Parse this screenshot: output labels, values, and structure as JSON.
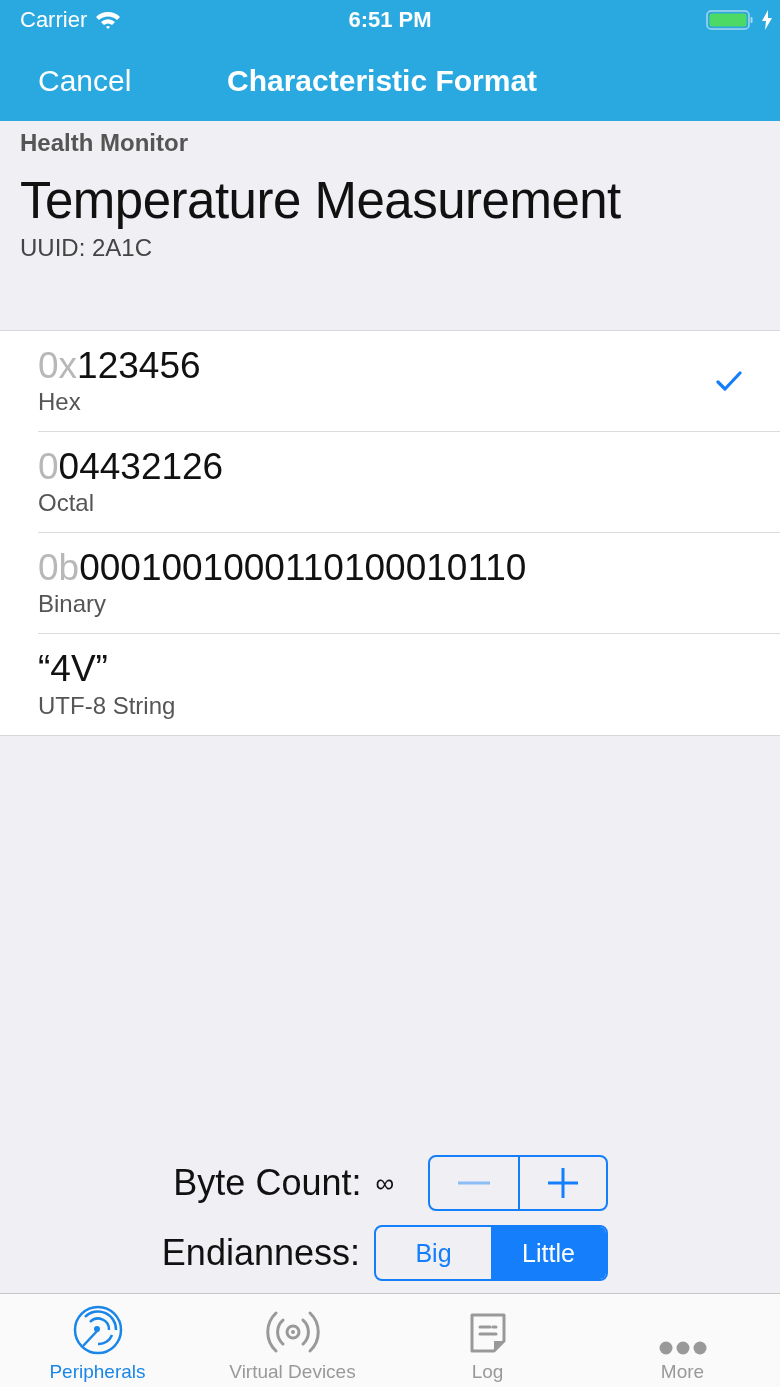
{
  "status_bar": {
    "carrier": "Carrier",
    "time": "6:51 PM"
  },
  "nav_bar": {
    "left_button": "Cancel",
    "title": "Characteristic Format"
  },
  "header": {
    "service": "Health Monitor",
    "characteristic": "Temperature Measurement",
    "uuid": "UUID: 2A1C"
  },
  "formats": [
    {
      "prefix": "0x",
      "value": "123456",
      "label": "Hex",
      "selected": true
    },
    {
      "prefix": "0",
      "value": "04432126",
      "label": "Octal",
      "selected": false
    },
    {
      "prefix": "0b",
      "value": "0001001000110100010110",
      "label": "Binary",
      "selected": false
    },
    {
      "value": "“4V”",
      "label": "UTF-8 String",
      "selected": false
    }
  ],
  "byte_count": {
    "label": "Byte Count:",
    "value": "∞",
    "minus_disabled": true,
    "plus_disabled": false
  },
  "endianness": {
    "label": "Endianness:",
    "segments": [
      {
        "label": "Big",
        "selected": false
      },
      {
        "label": "Little",
        "selected": true
      }
    ]
  },
  "tab_bar": [
    {
      "kind": "radar",
      "label": "Peripherals",
      "selected": true
    },
    {
      "kind": "broadcast",
      "label": "Virtual Devices",
      "selected": false
    },
    {
      "kind": "note",
      "label": "Log",
      "selected": false
    },
    {
      "kind": "more",
      "label": "More",
      "selected": false
    }
  ]
}
